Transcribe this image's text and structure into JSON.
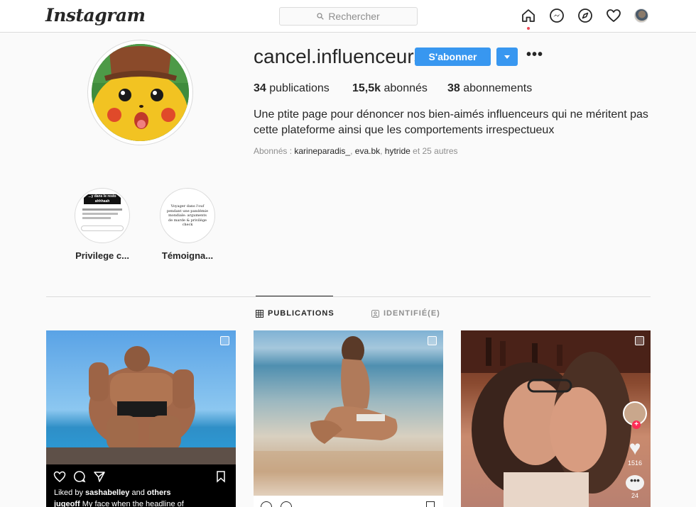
{
  "header": {
    "logo": "Instagram",
    "search": {
      "placeholder": "Rechercher"
    },
    "nav": [
      "home-icon",
      "messenger-icon",
      "explore-icon",
      "activity-heart-icon",
      "profile-avatar"
    ]
  },
  "profile": {
    "username": "cancel.influenceurs",
    "follow_label": "S'abonner",
    "stats": {
      "posts_count": "34",
      "posts_label": "publications",
      "followers_count": "15,5k",
      "followers_label": "abonnés",
      "following_count": "38",
      "following_label": "abonnements"
    },
    "bio": "Une ptite page pour dénoncer nos bien-aimés influenceurs qui ne méritent pas cette plateforme ainsi que les comportements irrespectueux",
    "followed_by": {
      "prefix": "Abonnés : ",
      "name1": "karineparadis_",
      "sep1": ", ",
      "name2": "eva.bk",
      "sep2": ", ",
      "name3": "hytride",
      "suffix": " et 25 autres"
    }
  },
  "highlights": [
    {
      "label": "Privilege c...",
      "thumb_header": "...y dans le resto ahhhaah"
    },
    {
      "label": "Témoigna...",
      "thumb_text": "Voyager dans l'ouf pendant une pandémie mondiale: arguments de marde & privilège check"
    }
  ],
  "tabs": {
    "publications": "PUBLICATIONS",
    "tagged": "IDENTIFIÉ(E)"
  },
  "posts": [
    {
      "liked_by_prefix": "Liked by ",
      "liked_by_user": "sashabelley",
      "liked_by_and": " and ",
      "liked_by_others": "others",
      "caption_user": "jugeoff",
      "caption_text": " My face when the headline of"
    },
    {},
    {
      "likes": "1516",
      "comments": "24"
    }
  ],
  "colors": {
    "accent": "#3897f0",
    "border": "#dbdbdb",
    "muted": "#8e8e8e",
    "notify": "#ed4956"
  }
}
